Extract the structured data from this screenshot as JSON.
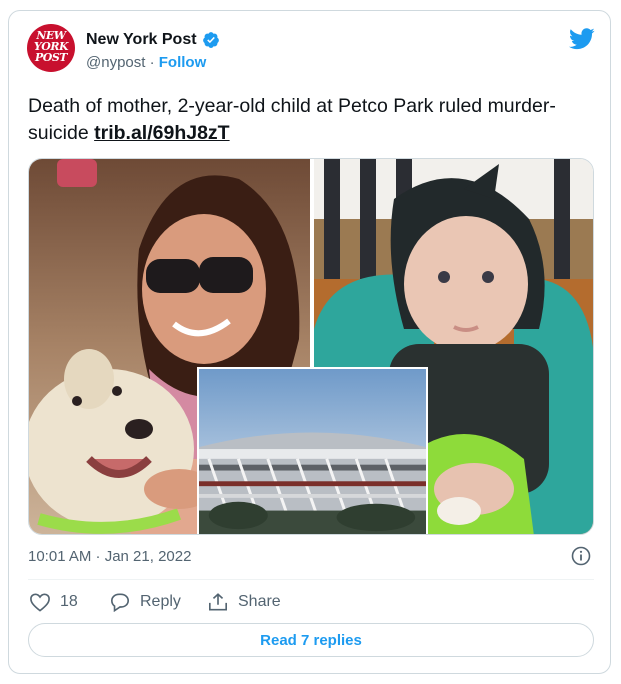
{
  "account": {
    "name": "New York Post",
    "handle": "@nypost",
    "separator": "·",
    "follow_label": "Follow",
    "logo_lines": [
      "NEW",
      "YORK",
      "POST"
    ],
    "brand_color": "#c8102e",
    "verified_icon": "verified-badge-icon"
  },
  "tweet": {
    "text": "Death of mother, 2-year-old child at Petco Park ruled murder-suicide",
    "link": "trib.al/69hJ8zT",
    "timestamp": "10:01 AM · Jan 21, 2022"
  },
  "media": {
    "images": [
      "woman-with-dog-photo",
      "baby-in-highchair-photo",
      "stadium-photo"
    ]
  },
  "actions": {
    "likes_count": "18",
    "reply_label": "Reply",
    "share_label": "Share",
    "read_replies_label": "Read 7 replies"
  },
  "colors": {
    "accent": "#1d9bf0",
    "text_primary": "#0f1419",
    "text_secondary": "#536471",
    "border": "#cfd9de"
  }
}
